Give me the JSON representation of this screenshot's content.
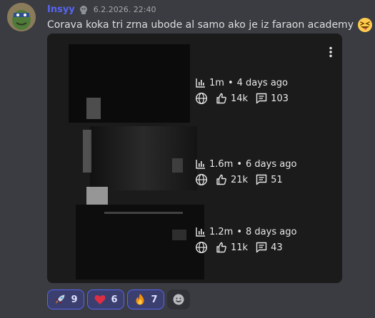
{
  "message": {
    "author": "Insyy",
    "timestamp": "6.2.2026. 22:40",
    "text": "Corava koka tri zrna ubode al samo ako je iz faraon academy",
    "text_emoji": "squinting-face-with-tongue-icon"
  },
  "attachment": {
    "menu_icon": "kebab-menu-icon",
    "videos": [
      {
        "views": "1m",
        "age": "4 days ago",
        "likes": "14k",
        "comments": "103"
      },
      {
        "views": "1.6m",
        "age": "6 days ago",
        "likes": "21k",
        "comments": "51"
      },
      {
        "views": "1.2m",
        "age": "8 days ago",
        "likes": "11k",
        "comments": "43"
      }
    ],
    "separator": "•"
  },
  "reactions": [
    {
      "emoji": "rocket-icon",
      "count": "9"
    },
    {
      "emoji": "red-heart-icon",
      "count": "6"
    },
    {
      "emoji": "fire-icon",
      "count": "7"
    }
  ],
  "colors": {
    "username": "#5865f2",
    "reaction_bg": "#3b3f70",
    "reaction_border": "#5865f2",
    "message_bg": "#3a3c42"
  }
}
